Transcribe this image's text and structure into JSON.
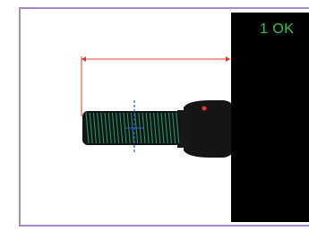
{
  "inspection": {
    "status_text": "1 OK",
    "status_color": "#35c24a",
    "frame_color": "#a78bc6",
    "panel_color": "#000000",
    "measure_color": "#e03c2a",
    "thread_color": "#1fa36b",
    "centerline_color": "#2b5fd6"
  }
}
